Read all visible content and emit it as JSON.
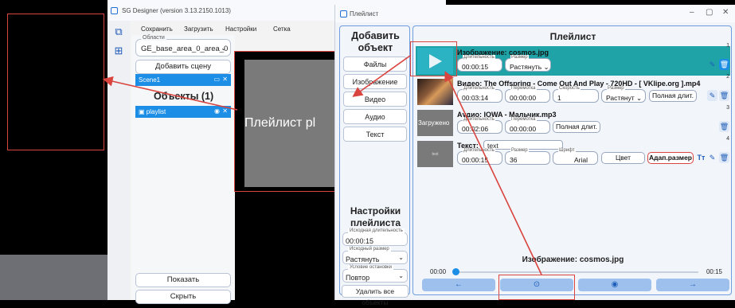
{
  "designer": {
    "title": "SG Designer (version 3.13.2150.1013)",
    "menu": [
      "Сохранить",
      "Загрузить",
      "Настройки",
      "Сетка"
    ],
    "areas_legend": "Области",
    "area_value": "GE_base_area_0_area_0",
    "add_scene_label": "Добавить сцену",
    "scene_label": "Scene1",
    "objects_heading": "Объекты (1)",
    "object_label": "playlist",
    "show_label": "Показать",
    "hide_label": "Скрыть",
    "preview_text": "Плейлист pl"
  },
  "playlist": {
    "window_title": "Плейлист",
    "add_heading": "Добавить объект",
    "add_buttons": [
      "Файлы",
      "Изображение",
      "Видео",
      "Аудио",
      "Текст"
    ],
    "settings_heading": "Настройки плейлиста",
    "initial_duration_legend": "Исходная длительность",
    "initial_duration": "00:00:15",
    "initial_size_legend": "Исходный размер",
    "initial_size": "Растянуть",
    "stop_condition_legend": "Условие остановки",
    "stop_condition": "Повтор",
    "delete_all_label": "Удалить все объекты",
    "list_heading": "Плейлист",
    "items": [
      {
        "num": "1",
        "title": "Изображение: cosmos.jpg",
        "duration_legend": "Длительность",
        "duration": "00:00:15",
        "size_legend": "Размер",
        "size": "Растянуть ⌄"
      },
      {
        "num": "2",
        "title": "Видео: The Offspring - Come Out And Play - 720HD - [ VKlipe.org ].mp4",
        "duration_legend": "Длительность",
        "duration": "00:03:14",
        "rewind_legend": "Перемотка",
        "rewind": "00:00:00",
        "speed_legend": "Скорость",
        "speed": "1",
        "size_legend": "Размер",
        "size": "Растянут ⌄",
        "full_label": "Полная длит."
      },
      {
        "num": "3",
        "thumb_label": "Загружено",
        "title": "Аудио: IOWA - Мальчик.mp3",
        "duration_legend": "Длительность",
        "duration": "00:02:06",
        "rewind_legend": "Перемотка",
        "rewind": "00:00:00",
        "full_label": "Полная длит."
      },
      {
        "num": "4",
        "thumb_label": "text",
        "title": "Текст:",
        "text_value": "text",
        "duration_legend": "Длительность",
        "duration": "00:00:15",
        "size_legend": "Размер",
        "size": "36",
        "font_legend": "Шрифт",
        "font": "Arial",
        "color_label": "Цвет",
        "adapt_label": "Адап.размер",
        "tt_label": "Tт"
      }
    ],
    "now_playing": "Изображение: cosmos.jpg",
    "time_start": "00:00",
    "time_end": "00:15",
    "progress": 0.0
  },
  "colors": {
    "accent": "#1d8ee6",
    "selected_row": "#1fa3a6",
    "annotation": "#d9443f"
  }
}
